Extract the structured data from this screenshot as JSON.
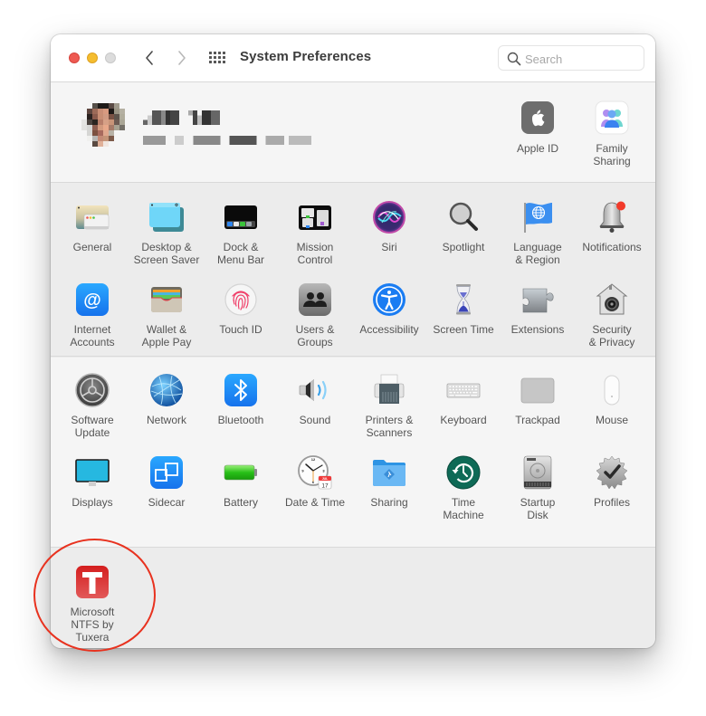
{
  "window": {
    "title": "System Preferences",
    "traffic_lights": {
      "close": "#ee5a52",
      "minimize": "#f5bd2f",
      "maximize": "#dcdcdc"
    },
    "nav": {
      "back_icon": "chevron-left-icon",
      "forward_icon": "chevron-right-icon",
      "show_all_icon": "grid-icon"
    }
  },
  "search": {
    "placeholder": "Search",
    "value": ""
  },
  "account": {
    "name": "[redacted]",
    "subtitle": "[redacted]",
    "items": [
      {
        "label": "Apple ID",
        "icon": "apple-id-icon"
      },
      {
        "label": "Family\nSharing",
        "icon": "family-sharing-icon"
      }
    ]
  },
  "section1": [
    {
      "label": "General",
      "icon": "general-icon"
    },
    {
      "label": "Desktop &\nScreen Saver",
      "icon": "desktop-icon"
    },
    {
      "label": "Dock &\nMenu Bar",
      "icon": "dock-icon"
    },
    {
      "label": "Mission\nControl",
      "icon": "mission-control-icon"
    },
    {
      "label": "Siri",
      "icon": "siri-icon"
    },
    {
      "label": "Spotlight",
      "icon": "spotlight-icon"
    },
    {
      "label": "Language\n& Region",
      "icon": "language-flag-icon"
    },
    {
      "label": "Notifications",
      "icon": "notifications-bell-icon"
    },
    {
      "label": "Internet\nAccounts",
      "icon": "internet-accounts-icon"
    },
    {
      "label": "Wallet &\nApple Pay",
      "icon": "wallet-icon"
    },
    {
      "label": "Touch ID",
      "icon": "fingerprint-icon"
    },
    {
      "label": "Users &\nGroups",
      "icon": "users-icon"
    },
    {
      "label": "Accessibility",
      "icon": "accessibility-icon"
    },
    {
      "label": "Screen Time",
      "icon": "hourglass-icon"
    },
    {
      "label": "Extensions",
      "icon": "puzzle-icon"
    },
    {
      "label": "Security\n& Privacy",
      "icon": "security-house-icon"
    }
  ],
  "section2": [
    {
      "label": "Software\nUpdate",
      "icon": "software-update-icon"
    },
    {
      "label": "Network",
      "icon": "network-globe-icon"
    },
    {
      "label": "Bluetooth",
      "icon": "bluetooth-icon"
    },
    {
      "label": "Sound",
      "icon": "speaker-icon"
    },
    {
      "label": "Printers &\nScanners",
      "icon": "printer-icon"
    },
    {
      "label": "Keyboard",
      "icon": "keyboard-icon"
    },
    {
      "label": "Trackpad",
      "icon": "trackpad-icon"
    },
    {
      "label": "Mouse",
      "icon": "mouse-icon"
    },
    {
      "label": "Displays",
      "icon": "display-icon"
    },
    {
      "label": "Sidecar",
      "icon": "sidecar-icon"
    },
    {
      "label": "Battery",
      "icon": "battery-icon"
    },
    {
      "label": "Date & Time",
      "icon": "clock-calendar-icon"
    },
    {
      "label": "Sharing",
      "icon": "sharing-folder-icon"
    },
    {
      "label": "Time\nMachine",
      "icon": "time-machine-icon"
    },
    {
      "label": "Startup\nDisk",
      "icon": "startup-disk-icon"
    },
    {
      "label": "Profiles",
      "icon": "profiles-badge-icon"
    }
  ],
  "calendar_badge": {
    "month": "JUL",
    "day": "17"
  },
  "section3": [
    {
      "label": "Microsoft\nNTFS by Tuxera",
      "icon": "tuxera-icon",
      "highlighted": true
    }
  ],
  "annotation": {
    "shape": "circle",
    "color": "#e8321f",
    "target": "Microsoft NTFS by Tuxera"
  }
}
